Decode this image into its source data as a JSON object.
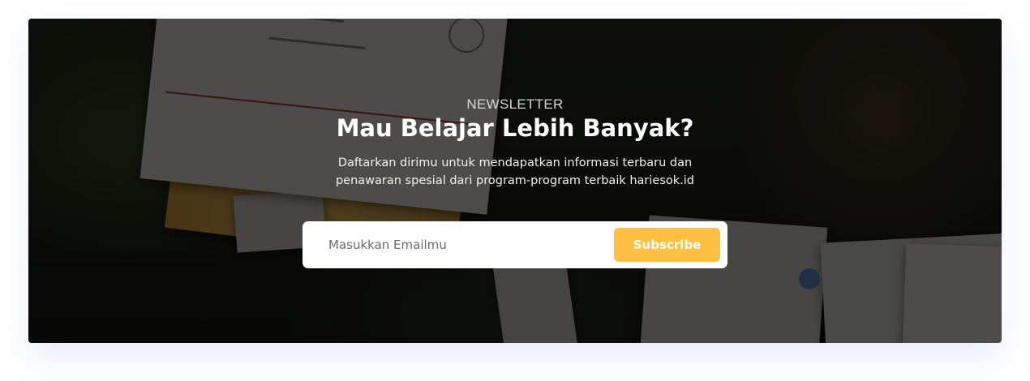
{
  "newsletter": {
    "eyebrow": "NEWSLETTER",
    "headline": "Mau Belajar Lebih Banyak?",
    "description_line1": "Daftarkan dirimu untuk mendapatkan informasi terbaru dan",
    "description_line2": "penawaran spesial dari program-program terbaik hariesok.id",
    "form": {
      "email_placeholder": "Masukkan Emailmu",
      "email_value": "",
      "subscribe_label": "Subscribe"
    }
  },
  "colors": {
    "accent": "#ffc042",
    "overlay": "#000000",
    "heading": "#ffffff",
    "page_background": "#ffffff"
  }
}
